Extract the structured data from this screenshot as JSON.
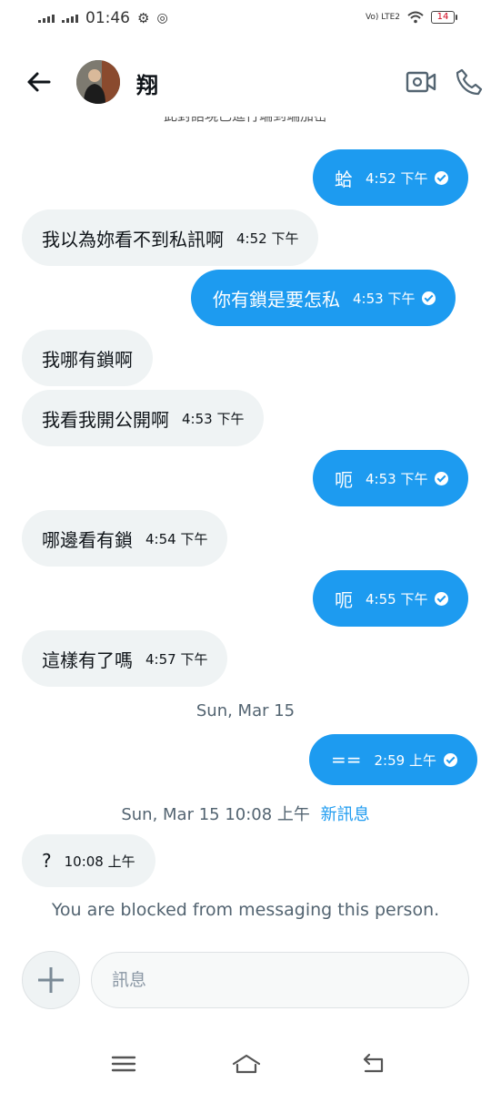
{
  "status_bar": {
    "time": "01:46",
    "network": "Vo) LTE2",
    "battery": "14"
  },
  "header": {
    "contact_name": "翔",
    "encryption_notice": "此對話現已進行端到端加密"
  },
  "messages": [
    {
      "dir": "out",
      "text": "蛤",
      "time": "4:52 下午"
    },
    {
      "dir": "in",
      "text": "我以為妳看不到私訊啊",
      "time": "4:52 下午"
    },
    {
      "dir": "out",
      "text": "你有鎖是要怎私",
      "time": "4:53 下午"
    },
    {
      "dir": "in",
      "text": "我哪有鎖啊",
      "time": ""
    },
    {
      "dir": "in",
      "text": "我看我開公開啊",
      "time": "4:53 下午"
    },
    {
      "dir": "out",
      "text": "呃",
      "time": "4:53 下午"
    },
    {
      "dir": "in",
      "text": "哪邊看有鎖",
      "time": "4:54 下午"
    },
    {
      "dir": "out",
      "text": "呃",
      "time": "4:55 下午"
    },
    {
      "dir": "in",
      "text": "這樣有了嗎",
      "time": "4:57 下午"
    },
    {
      "dir": "out",
      "text": "==",
      "time": "2:59 上午"
    },
    {
      "dir": "in",
      "text": "?",
      "time": "10:08 上午"
    }
  ],
  "date_divider": "Sun, Mar 15",
  "new_messages_divider": {
    "timestamp": "Sun, Mar 15 10:08 上午",
    "label": "新訊息"
  },
  "blocked_notice": "You are blocked from messaging this person.",
  "composer": {
    "placeholder": "訊息"
  },
  "colors": {
    "accent": "#1d9bf0",
    "incoming_bubble": "#eff3f4",
    "muted_text": "#536471"
  }
}
